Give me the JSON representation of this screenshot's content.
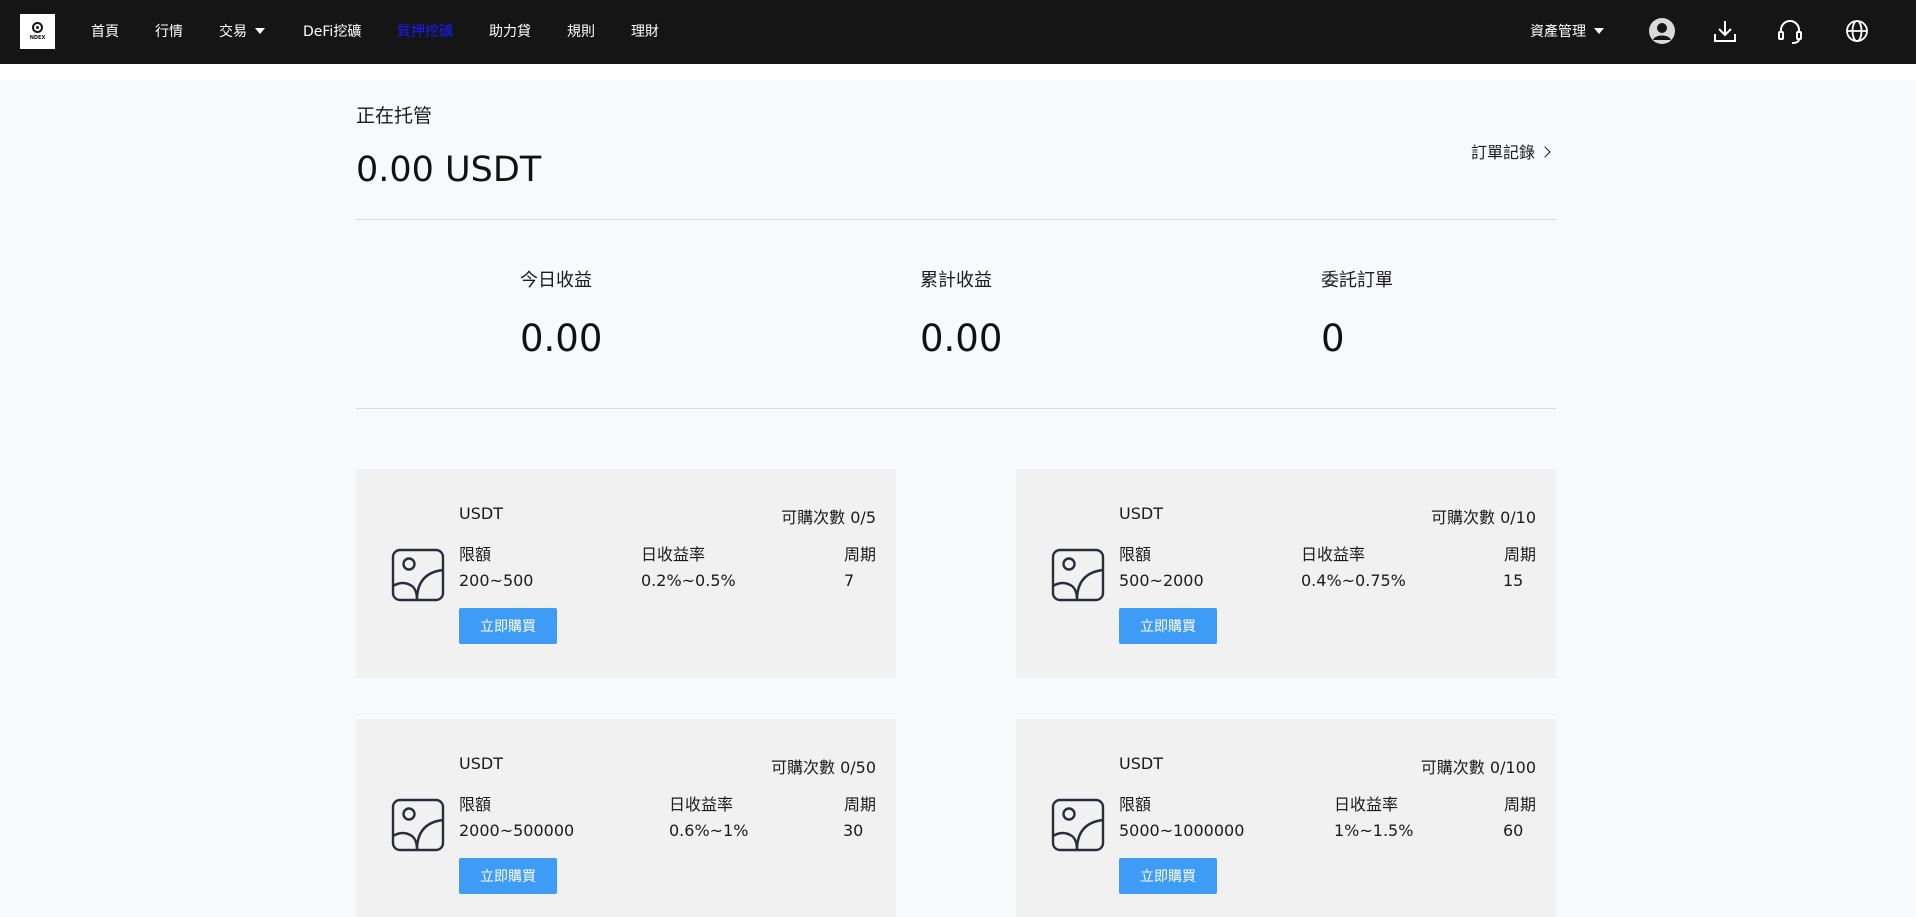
{
  "nav": {
    "logo_text": "NDEX",
    "items": [
      {
        "label": "首頁"
      },
      {
        "label": "行情"
      },
      {
        "label": "交易"
      },
      {
        "label": "DeFi挖礦"
      },
      {
        "label": "質押挖礦"
      },
      {
        "label": "助力貸"
      },
      {
        "label": "規則"
      },
      {
        "label": "理財"
      }
    ],
    "asset_menu": "資產管理",
    "icons": [
      "user-icon",
      "download-icon",
      "headset-icon",
      "globe-icon"
    ],
    "active_color": "#1a1aff"
  },
  "summary": {
    "title": "正在托管",
    "total": "0.00 USDT",
    "order_link": "訂單記錄",
    "stats": [
      {
        "label": "今日收益",
        "value": "0.00"
      },
      {
        "label": "累計收益",
        "value": "0.00"
      },
      {
        "label": "委託訂單",
        "value": "0"
      }
    ]
  },
  "product_labels": {
    "limit": "限額",
    "rate": "日收益率",
    "period": "周期",
    "buy": "立即購買",
    "remaining_prefix": "可購次數"
  },
  "products": [
    {
      "coin": "USDT",
      "remaining": "0/5",
      "limit": "200~500",
      "rate": "0.2%~0.5%",
      "period": "7"
    },
    {
      "coin": "USDT",
      "remaining": "0/10",
      "limit": "500~2000",
      "rate": "0.4%~0.75%",
      "period": "15"
    },
    {
      "coin": "USDT",
      "remaining": "0/50",
      "limit": "2000~500000",
      "rate": "0.6%~1%",
      "period": "30"
    },
    {
      "coin": "USDT",
      "remaining": "0/100",
      "limit": "5000~1000000",
      "rate": "1%~1.5%",
      "period": "60"
    }
  ],
  "colors": {
    "topbar": "#151515",
    "button": "#3e9bf6",
    "card": "#f1f1f1",
    "page": "#f8f9fc"
  }
}
